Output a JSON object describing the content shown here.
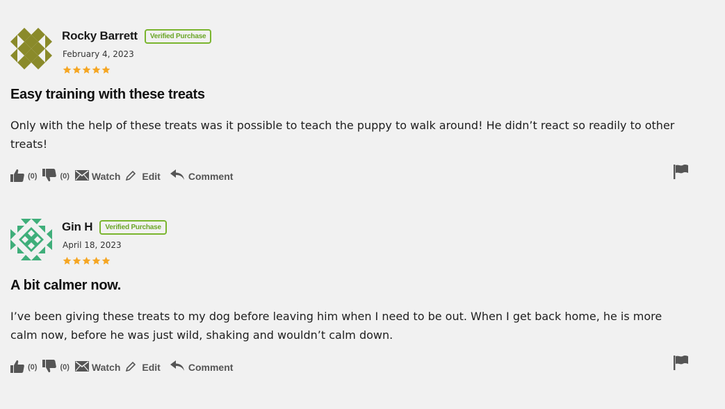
{
  "reviews": [
    {
      "author": "Rocky Barrett",
      "badge": "Verified Purchase",
      "date": "February 4, 2023",
      "rating": 5,
      "title": "Easy training with these treats",
      "body": "Only with the help of these treats was it possible to teach the puppy to walk around! He didn’t react so readily to other treats!",
      "likes": "(0)",
      "dislikes": "(0)",
      "avatar_color": "#8a8a2a",
      "avatar_icon": "identicon-avatar"
    },
    {
      "author": "Gin H",
      "badge": "Verified Purchase",
      "date": "April 18, 2023",
      "rating": 5,
      "title": "A bit calmer now.",
      "body": "I’ve been giving these treats to my dog before leaving him when I need to be out. When I get back home, he is more calm now, before he was just wild, shaking and wouldn’t calm down.",
      "likes": "(0)",
      "dislikes": "(0)",
      "avatar_color": "#3fae7a",
      "avatar_icon": "identicon-avatar"
    }
  ],
  "actions": {
    "watch_label": "Watch",
    "edit_label": "Edit",
    "comment_label": "Comment"
  },
  "colors": {
    "background": "#f1f1f1",
    "badge_green": "#7ab52e",
    "star_orange": "#f5a623",
    "action_gray": "#555555"
  },
  "icons": {
    "like": "thumbs-up-icon",
    "dislike": "thumbs-down-icon",
    "watch": "envelope-icon",
    "edit": "pencil-icon",
    "comment": "reply-icon",
    "report": "flag-icon",
    "star": "star-icon"
  }
}
